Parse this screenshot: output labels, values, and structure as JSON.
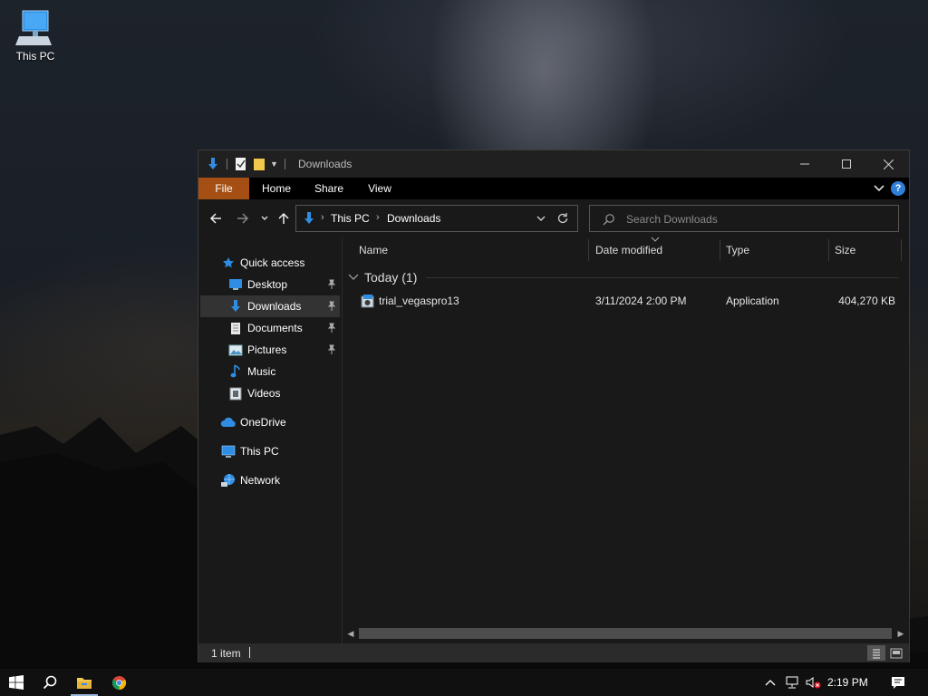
{
  "desktop": {
    "icons": [
      {
        "label": "This PC",
        "icon": "computer-icon"
      }
    ]
  },
  "window": {
    "title": "Downloads",
    "ribbon_tabs": {
      "file": "File",
      "home": "Home",
      "share": "Share",
      "view": "View"
    },
    "help_label": "?",
    "address": {
      "crumbs": [
        "This PC",
        "Downloads"
      ]
    },
    "search": {
      "placeholder": "Search Downloads"
    },
    "sidebar": {
      "quick_access": "Quick access",
      "items": [
        {
          "label": "Desktop",
          "icon": "desktop-icon",
          "pinned": true
        },
        {
          "label": "Downloads",
          "icon": "download-arrow-icon",
          "pinned": true,
          "selected": true
        },
        {
          "label": "Documents",
          "icon": "document-icon",
          "pinned": true
        },
        {
          "label": "Pictures",
          "icon": "picture-icon",
          "pinned": true
        },
        {
          "label": "Music",
          "icon": "music-note-icon",
          "pinned": false
        },
        {
          "label": "Videos",
          "icon": "video-icon",
          "pinned": false
        }
      ],
      "onedrive": "OneDrive",
      "this_pc": "This PC",
      "network": "Network"
    },
    "columns": {
      "name": "Name",
      "date": "Date modified",
      "type": "Type",
      "size": "Size"
    },
    "group": {
      "label": "Today (1)"
    },
    "files": [
      {
        "name": "trial_vegaspro13",
        "date": "3/11/2024 2:00 PM",
        "type": "Application",
        "size": "404,270 KB",
        "icon": "installer-icon"
      }
    ],
    "status": {
      "count": "1 item"
    },
    "accent_color": "#a64f15"
  },
  "taskbar": {
    "apps": [
      "start-icon",
      "search-icon",
      "file-explorer-icon",
      "chrome-icon"
    ],
    "tray": {
      "time": "2:19 PM"
    }
  }
}
